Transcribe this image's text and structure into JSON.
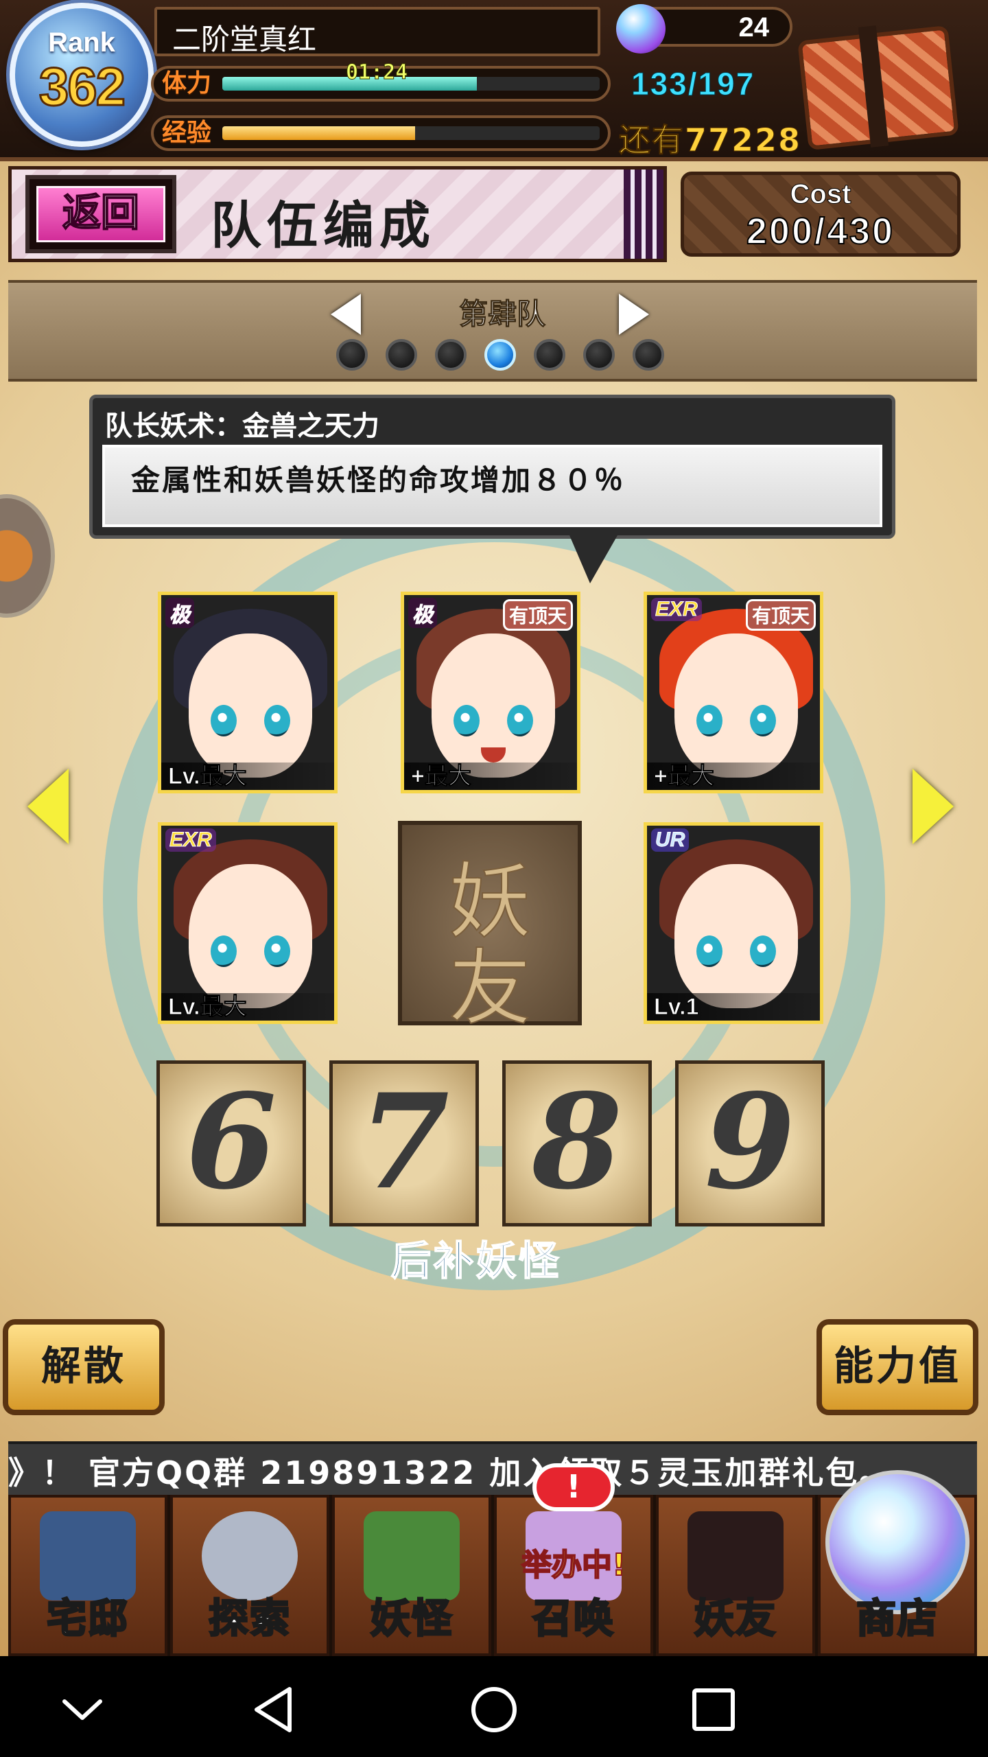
{
  "player": {
    "rank_label": "Rank",
    "rank": "362",
    "name": "二阶堂真红",
    "stamina_label": "体力",
    "stamina_timer": "01:24",
    "stamina": "133/197",
    "stamina_fraction": 0.675,
    "exp_label": "经验",
    "exp_fraction": 0.51,
    "exp_remaining": "还有77228",
    "gems": "24"
  },
  "banner": {
    "back_label": "返回",
    "title": "队伍编成",
    "cost_label": "Cost",
    "cost_value": "200/430"
  },
  "team_selector": {
    "team_name": "第肆队",
    "dots": 7,
    "active_index": 3
  },
  "leader_skill": {
    "title": "队长妖术：金兽之天力",
    "description": "金属性和妖兽妖怪的命攻增加８０％"
  },
  "cards": [
    {
      "rarity": "极",
      "level": "Lv.最大",
      "tag": "",
      "hair_color": "#2a2a3a"
    },
    {
      "rarity": "极",
      "level": "+最大",
      "tag": "有顶天",
      "hair_color": "#7a3a2a"
    },
    {
      "rarity": "EXR",
      "level": "+最大",
      "tag": "有顶天",
      "hair_color": "#e2401a"
    },
    {
      "rarity": "EXR",
      "level": "Lv.最大",
      "tag": "",
      "hair_color": "#6a2f22"
    },
    {
      "rarity": "UR",
      "level": "Lv.1",
      "tag": "",
      "hair_color": "#6a2f22"
    }
  ],
  "friend_slot": {
    "char_top": "妖",
    "char_bottom": "友"
  },
  "bench": {
    "slots": [
      "6",
      "7",
      "8",
      "9"
    ],
    "caption": "后补妖怪"
  },
  "actions": {
    "disband_label": "解散",
    "stats_label": "能力值"
  },
  "ticker": {
    "text": "》！ 官方QQ群 219891322    加入领取５灵玉加群礼包。"
  },
  "nav": [
    {
      "label": "宅邸",
      "color": "#3a5a8a"
    },
    {
      "label": "探索",
      "color": "#b0b8c8"
    },
    {
      "label": "妖怪",
      "color": "#4a8a3a"
    },
    {
      "label": "召唤",
      "event": "举办中!",
      "alert": "!",
      "color": "#c8a0e0"
    },
    {
      "label": "妖友",
      "color": "#2a1a1a"
    },
    {
      "label": "商店",
      "color": "#6a8ae0"
    }
  ],
  "system_nav": [
    "chevron-down-icon",
    "back-icon",
    "home-icon",
    "recents-icon"
  ]
}
